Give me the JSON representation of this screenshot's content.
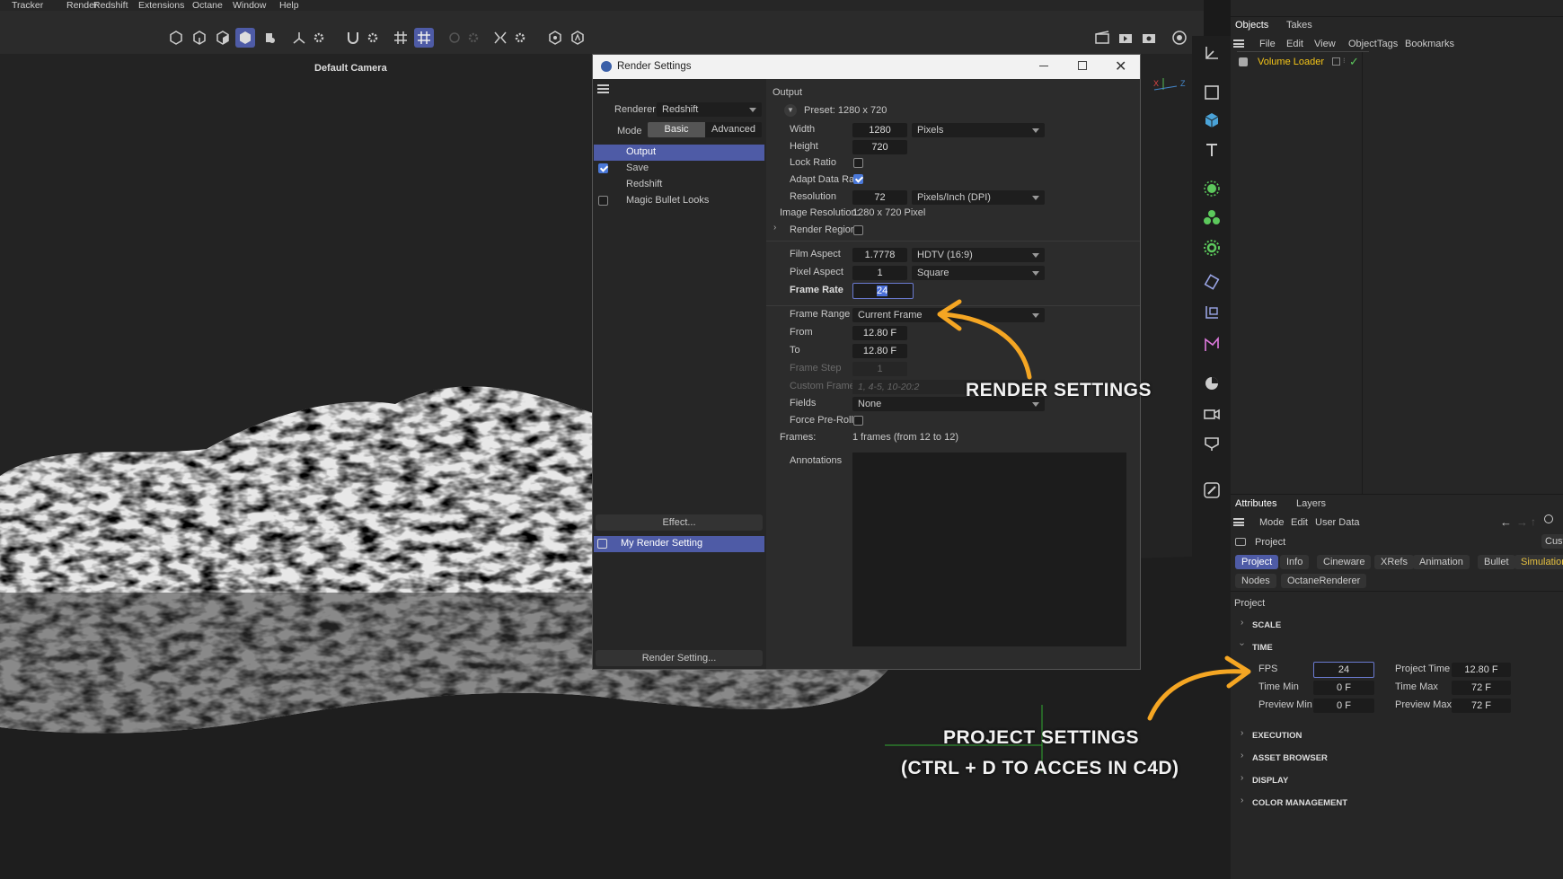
{
  "menu": [
    "Tracker",
    "Render",
    "Redshift",
    "Extensions",
    "Octane",
    "Window",
    "Help"
  ],
  "viewport": {
    "camera": "Default Camera",
    "axis_x": "X",
    "axis_z": "Z"
  },
  "dialog": {
    "title": "Render Settings",
    "renderer_label": "Renderer",
    "renderer_value": "Redshift",
    "mode_label": "Mode",
    "mode_basic": "Basic",
    "mode_advanced": "Advanced",
    "left_items": [
      {
        "label": "Output",
        "checked": null,
        "selected": true
      },
      {
        "label": "Save",
        "checked": true,
        "selected": false
      },
      {
        "label": "Redshift",
        "checked": null,
        "selected": false
      },
      {
        "label": "Magic Bullet Looks",
        "checked": false,
        "selected": false
      }
    ],
    "effect_button": "Effect...",
    "render_setting_item": "My Render Setting",
    "render_setting_button": "Render Setting...",
    "output": {
      "header": "Output",
      "preset": "Preset: 1280 x 720",
      "width_label": "Width",
      "width_value": "1280",
      "width_unit": "Pixels",
      "height_label": "Height",
      "height_value": "720",
      "lock_ratio": "Lock Ratio",
      "adapt_data_rate": "Adapt Data Rate",
      "resolution_label": "Resolution",
      "resolution_value": "72",
      "resolution_unit": "Pixels/Inch (DPI)",
      "image_resolution_label": "Image Resolution:",
      "image_resolution_value": "1280 x 720 Pixel",
      "render_region": "Render Region",
      "film_aspect_label": "Film Aspect",
      "film_aspect_value": "1.7778",
      "film_aspect_preset": "HDTV (16:9)",
      "pixel_aspect_label": "Pixel Aspect",
      "pixel_aspect_value": "1",
      "pixel_aspect_preset": "Square",
      "frame_rate_label": "Frame Rate",
      "frame_rate_value": "24",
      "frame_range_label": "Frame Range",
      "frame_range_value": "Current Frame",
      "from_label": "From",
      "from_value": "12.80 F",
      "to_label": "To",
      "to_value": "12.80 F",
      "frame_step_label": "Frame Step",
      "frame_step_value": "1",
      "custom_frames_label": "Custom Frames",
      "custom_frames_value": "1, 4-5, 10-20:2",
      "fields_label": "Fields",
      "fields_value": "None",
      "force_preroll": "Force Pre-Roll",
      "frames_label": "Frames:",
      "frames_value": "1 frames (from 12 to 12)",
      "annotations_label": "Annotations"
    }
  },
  "objects_panel": {
    "tabs": [
      "Objects",
      "Takes"
    ],
    "menu": [
      "File",
      "Edit",
      "View",
      "Object",
      "Tags",
      "Bookmarks"
    ],
    "item": "Volume Loader"
  },
  "attributes_panel": {
    "tabs": [
      "Attributes",
      "Layers"
    ],
    "menu": [
      "Mode",
      "Edit",
      "User Data"
    ],
    "project_label": "Project",
    "custom_cut": "Cust",
    "pills_row1": [
      "Project",
      "Info",
      "Cineware",
      "XRefs",
      "Animation",
      "Bullet",
      "Simulation"
    ],
    "pills_row2": [
      "Nodes",
      "OctaneRenderer"
    ],
    "section_title": "Project",
    "groups": [
      "SCALE",
      "TIME",
      "EXECUTION",
      "ASSET BROWSER",
      "DISPLAY",
      "COLOR MANAGEMENT"
    ],
    "time": {
      "fps_label": "FPS",
      "fps_value": "24",
      "project_time_label": "Project Time",
      "project_time_value": "12.80 F",
      "time_min_label": "Time Min",
      "time_min_value": "0 F",
      "time_max_label": "Time Max",
      "time_max_value": "72 F",
      "preview_min_label": "Preview Min",
      "preview_min_value": "0 F",
      "preview_max_label": "Preview Max",
      "preview_max_value": "72 F"
    }
  },
  "annotations": {
    "render_settings": "RENDER SETTINGS",
    "project_settings_line1": "PROJECT SETTINGS",
    "project_settings_line2": "(CTRL + D TO ACCES IN C4D)",
    "arrow_color": "#f5a623"
  },
  "colors": {
    "accent": "#4e5ba6",
    "highlight_text": "#f5c518",
    "checkbox_blue": "#4a78d8"
  }
}
